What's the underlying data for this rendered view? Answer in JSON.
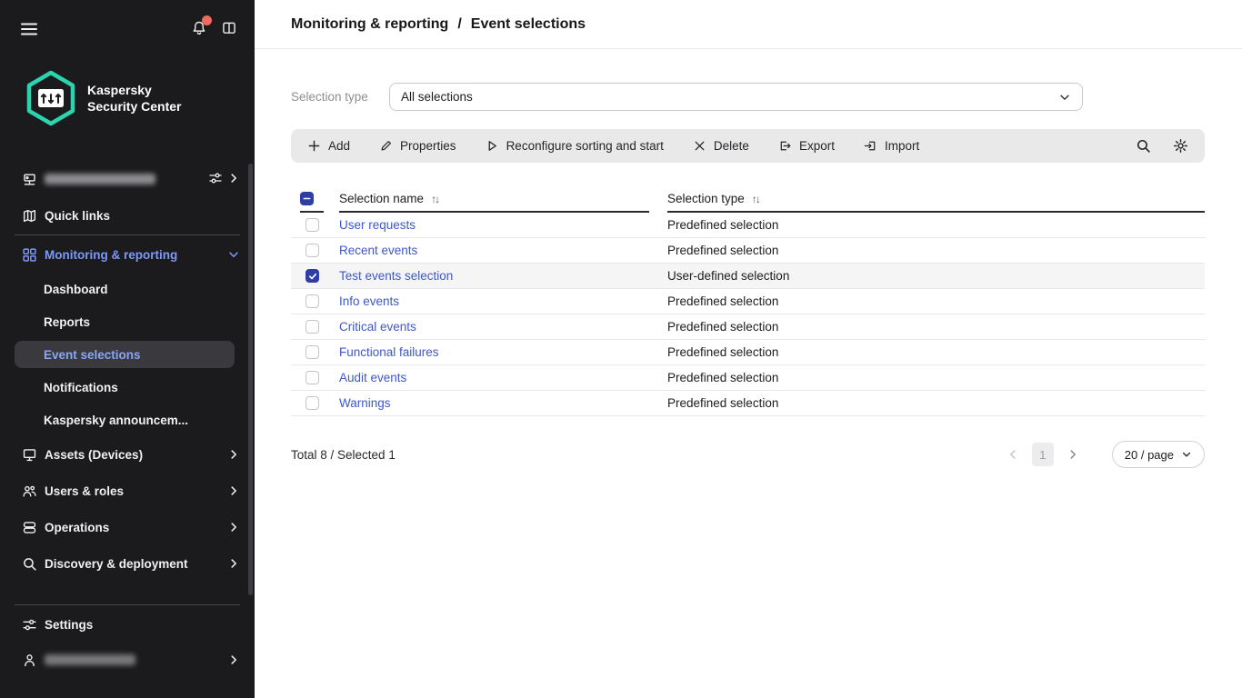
{
  "colors": {
    "sidebar_bg": "#1b1b1d",
    "accent_link_blue": "#3f57cc",
    "sidebar_item_blue": "#7d99f7",
    "brand_teal": "#2bd4ae",
    "alert_red": "#ef6a5f",
    "checkbox_indigo": "#2f3da6",
    "toolbar_bg": "#e9e9ea",
    "selected_row_bg": "#f5f5f6"
  },
  "sidebar": {
    "logo_line1": "Kaspersky",
    "logo_line2": "Security Center",
    "items": [
      {
        "label": "",
        "icon": "server-icon",
        "redacted": true
      },
      {
        "label": "Quick links",
        "icon": "map-icon"
      },
      {
        "label": "Monitoring & reporting",
        "icon": "grid-icon",
        "expanded": true
      },
      {
        "label": "Dashboard"
      },
      {
        "label": "Reports"
      },
      {
        "label": "Event selections",
        "selected": true
      },
      {
        "label": "Notifications"
      },
      {
        "label": "Kaspersky announcem..."
      },
      {
        "label": "Assets (Devices)",
        "icon": "monitor-icon"
      },
      {
        "label": "Users & roles",
        "icon": "users-icon"
      },
      {
        "label": "Operations",
        "icon": "stack-icon"
      },
      {
        "label": "Discovery & deployment",
        "icon": "search-icon"
      },
      {
        "label": "Settings",
        "icon": "sliders-icon"
      },
      {
        "label": "",
        "icon": "user-icon",
        "redacted": true
      }
    ]
  },
  "header": {
    "breadcrumb": [
      "Monitoring & reporting",
      "Event selections"
    ],
    "separator": "/"
  },
  "filter": {
    "label": "Selection type",
    "value": "All selections"
  },
  "toolbar": {
    "buttons": [
      {
        "label": "Add",
        "icon": "plus-icon"
      },
      {
        "label": "Properties",
        "icon": "pencil-icon"
      },
      {
        "label": "Reconfigure sorting and start",
        "icon": "play-icon"
      },
      {
        "label": "Delete",
        "icon": "x-icon"
      },
      {
        "label": "Export",
        "icon": "export-icon"
      },
      {
        "label": "Import",
        "icon": "import-icon"
      }
    ]
  },
  "table": {
    "sort_glyph": "↑↓",
    "header_checkbox": "indeterminate",
    "columns": [
      {
        "label": "Selection name",
        "sortable": true
      },
      {
        "label": "Selection type",
        "sortable": true
      }
    ],
    "rows": [
      {
        "name": "User requests",
        "type": "Predefined selection",
        "checked": false
      },
      {
        "name": "Recent events",
        "type": "Predefined selection",
        "checked": false
      },
      {
        "name": "Test events selection",
        "type": "User-defined selection",
        "checked": true
      },
      {
        "name": "Info events",
        "type": "Predefined selection",
        "checked": false
      },
      {
        "name": "Critical events",
        "type": "Predefined selection",
        "checked": false
      },
      {
        "name": "Functional failures",
        "type": "Predefined selection",
        "checked": false
      },
      {
        "name": "Audit events",
        "type": "Predefined selection",
        "checked": false
      },
      {
        "name": "Warnings",
        "type": "Predefined selection",
        "checked": false
      }
    ]
  },
  "footer": {
    "summary": "Total 8 / Selected 1",
    "page": "1",
    "page_size": "20 / page"
  }
}
